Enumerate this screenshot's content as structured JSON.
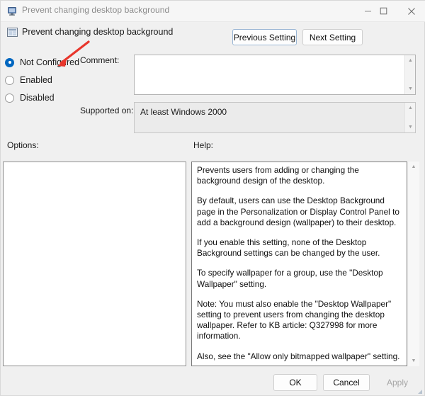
{
  "window": {
    "title": "Prevent changing desktop background",
    "title_icon": "monitor-icon",
    "minimize_glyph": "—",
    "maximize_glyph": "☐",
    "close_glyph": "✕"
  },
  "header": {
    "policy_name": "Prevent changing desktop background",
    "icon": "policy-setting-icon"
  },
  "navigation": {
    "previous_setting": "Previous Setting",
    "next_setting": "Next Setting"
  },
  "state_options": [
    {
      "label": "Not Configured",
      "selected": true
    },
    {
      "label": "Enabled",
      "selected": false
    },
    {
      "label": "Disabled",
      "selected": false
    }
  ],
  "comment": {
    "label": "Comment:",
    "value": "",
    "placeholder": ""
  },
  "supported_on": {
    "label": "Supported on:",
    "value": "At least Windows 2000"
  },
  "panels": {
    "options_label": "Options:",
    "options_content": "",
    "help_label": "Help:"
  },
  "help": {
    "paragraphs": [
      "Prevents users from adding or changing the background design of the desktop.",
      "By default, users can use the Desktop Background page in the Personalization or Display Control Panel to add a background design (wallpaper) to their desktop.",
      "If you enable this setting, none of the Desktop Background settings can be changed by the user.",
      "To specify wallpaper for a group, use the \"Desktop Wallpaper\" setting.",
      "Note: You must also enable the \"Desktop Wallpaper\" setting to prevent users from changing the desktop wallpaper. Refer to KB article: Q327998 for more information.",
      "Also, see the \"Allow only bitmapped wallpaper\" setting."
    ]
  },
  "footer": {
    "ok": "OK",
    "cancel": "Cancel",
    "apply": "Apply",
    "apply_disabled": true
  },
  "annotation": {
    "arrow_color": "#e8362c",
    "points_to": "Not Configured"
  },
  "colors": {
    "window_bg": "#f0f0f0",
    "accent": "#0067c0",
    "focus_border": "#9ab6d4",
    "text": "#1a1a1a",
    "title_text": "#8b8b8b",
    "disabled_text": "#a6a6a6"
  }
}
